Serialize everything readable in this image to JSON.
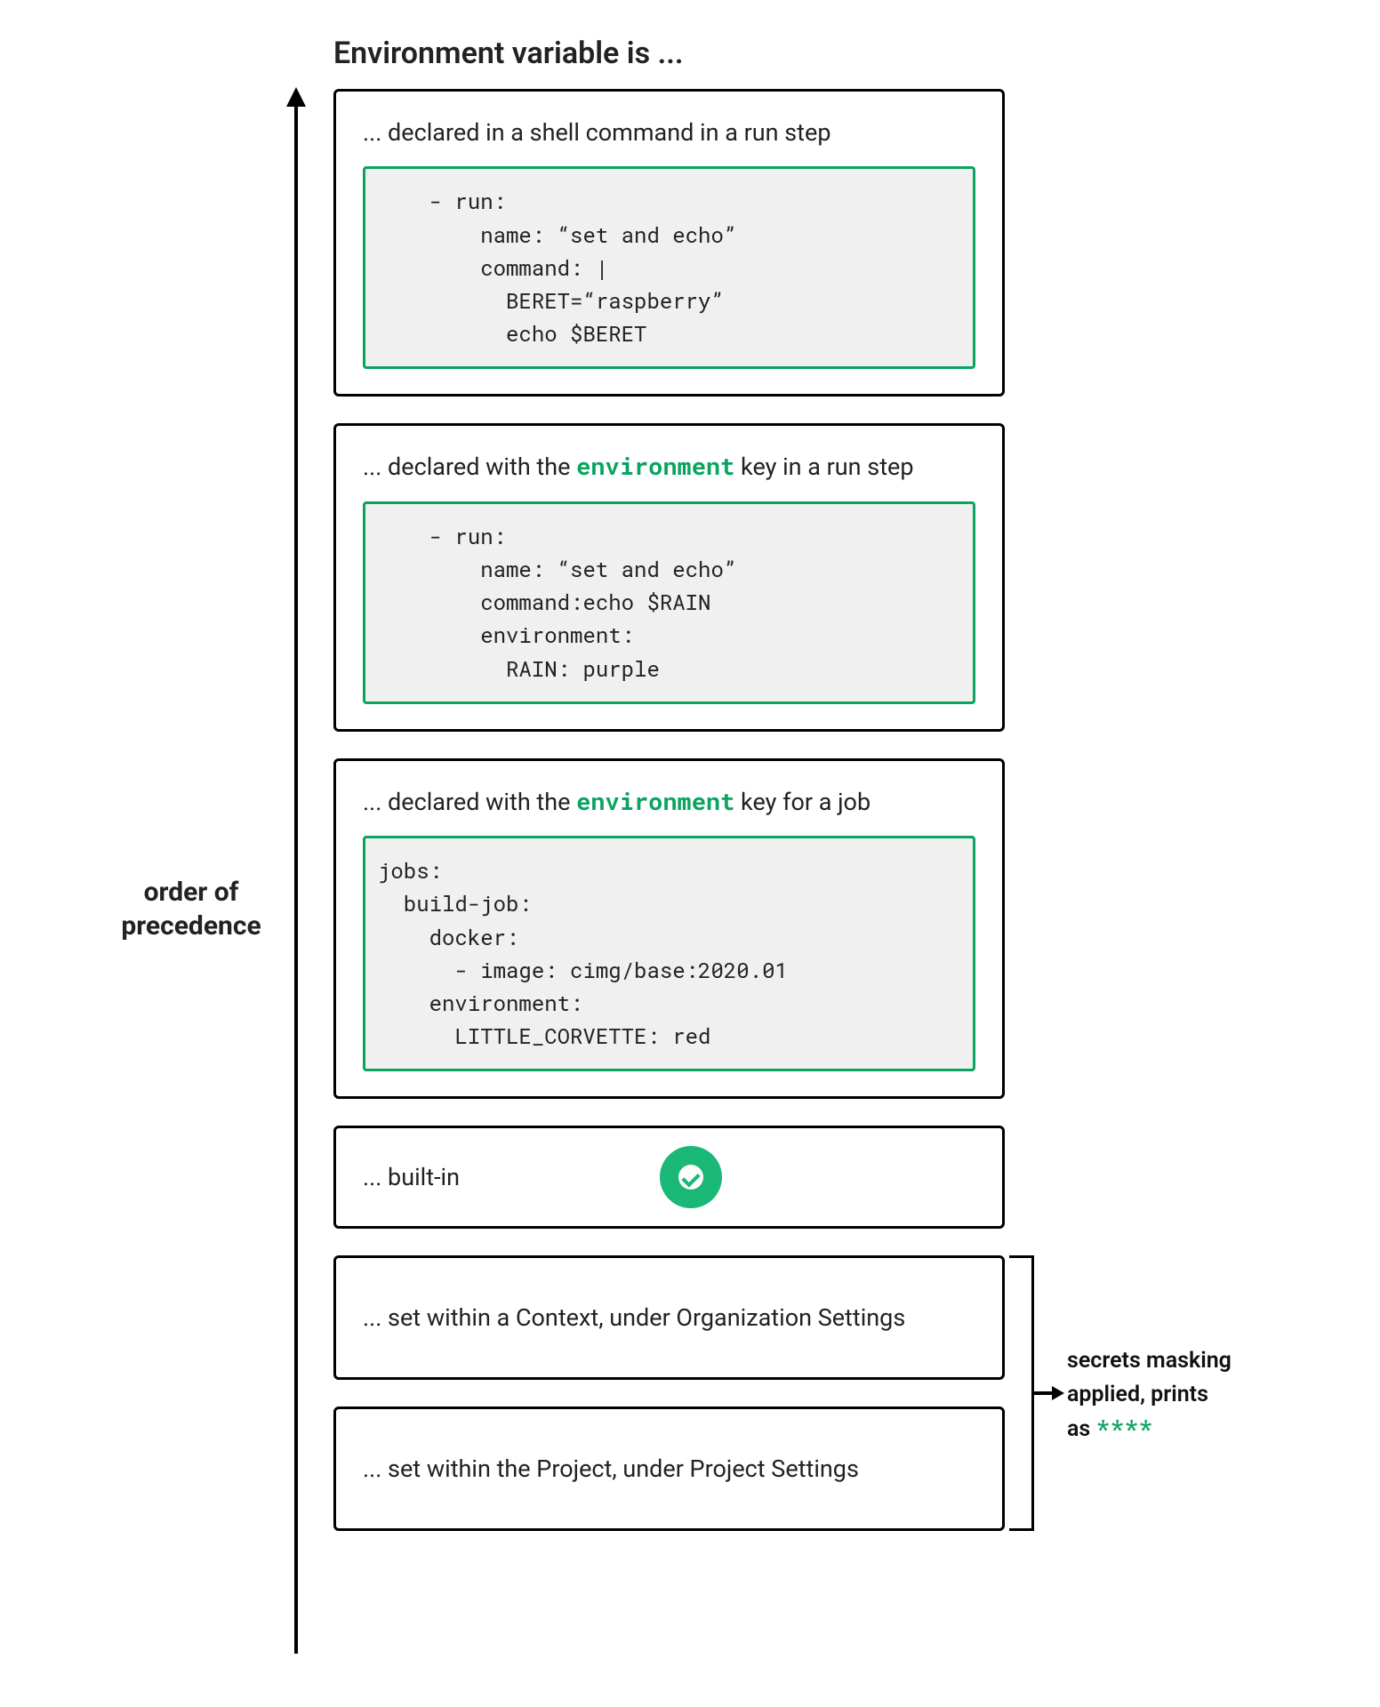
{
  "title": "Environment variable is ...",
  "left_label_line1": "order of",
  "left_label_line2": "precedence",
  "keyword_environment": "environment",
  "cards": {
    "shell": {
      "desc_prefix": "... declared in a shell command in a run step",
      "code": "    - run:\n        name: “set and echo”\n        command: |\n          BERET=“raspberry”\n          echo $BERET"
    },
    "run_env": {
      "desc_prefix": "... declared with the ",
      "desc_suffix": " key in a run step",
      "code": "    - run:\n        name: “set and echo”\n        command:echo $RAIN\n        environment:\n          RAIN: purple"
    },
    "job_env": {
      "desc_prefix": "... declared with the ",
      "desc_suffix": " key for a job",
      "code": "jobs:\n  build-job:\n    docker:\n      - image: cimg/base:2020.01\n    environment:\n      LITTLE_CORVETTE: red"
    },
    "builtin": {
      "desc": "... built-in"
    },
    "context": {
      "desc": "... set within a Context, under Organization Settings"
    },
    "project": {
      "desc": "... set within the Project, under Project Settings"
    }
  },
  "secrets_note": {
    "line1": "secrets masking",
    "line2": "applied, prints",
    "line3_prefix": "as ",
    "mask": "****"
  }
}
